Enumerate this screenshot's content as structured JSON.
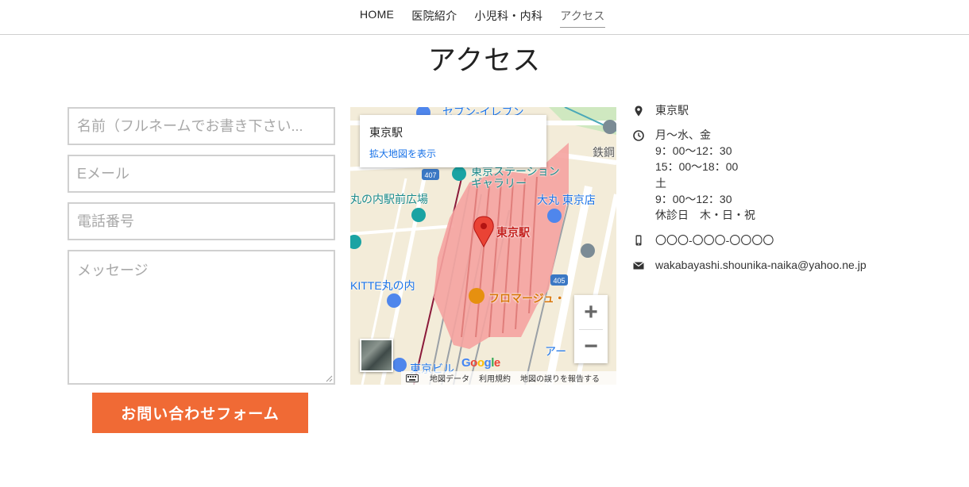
{
  "nav": {
    "items": [
      {
        "label": "HOME"
      },
      {
        "label": "医院紹介"
      },
      {
        "label": "小児科・内科"
      },
      {
        "label": "アクセス",
        "active": true
      }
    ]
  },
  "page": {
    "title": "アクセス"
  },
  "form": {
    "name_placeholder": "名前（フルネームでお書き下さい...",
    "email_placeholder": "Eメール",
    "phone_placeholder": "電話番号",
    "message_placeholder": "メッセージ",
    "submit_label": "お問い合わせフォーム",
    "submit_color": "#f06a35"
  },
  "map": {
    "card_title": "東京駅",
    "card_link": "拡大地図を表示",
    "pin_label": "東京駅",
    "labels": {
      "seven": "セブン-イレブン",
      "station_gallery_1": "東京ステーション",
      "station_gallery_2": "ギャラリー",
      "marunouchi_plaza": "丸の内駅前広場",
      "daimaru": "大丸 東京店",
      "kitte": "KITTE丸の内",
      "fromage": "フロマージュ・",
      "tekko": "鉄鋼",
      "ar": "アー",
      "tokyo_build": "東京ビル",
      "road_407": "407",
      "road_405": "405"
    },
    "footer": {
      "map_data": "地図データ",
      "terms": "利用規約",
      "report": "地図の誤りを報告する"
    },
    "google": [
      "G",
      "o",
      "o",
      "g",
      "l",
      "e"
    ],
    "zoom_in": "+",
    "zoom_out": "−"
  },
  "info": {
    "location": "東京駅",
    "hours": [
      "月〜水、金",
      "9：00〜12：30",
      "15：00〜18：00",
      "土",
      "9：00〜12：30",
      "休診日　木・日・祝"
    ],
    "phone": "〇〇〇-〇〇〇-〇〇〇〇",
    "email": "wakabayashi.shounika-naika@yahoo.ne.jp"
  }
}
